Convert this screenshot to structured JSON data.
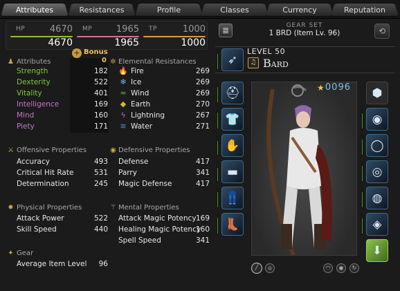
{
  "tabs": [
    {
      "label": "Attributes",
      "active": true
    },
    {
      "label": "Resistances",
      "active": false
    },
    {
      "label": "Profile",
      "active": false
    },
    {
      "label": "Classes",
      "active": false
    },
    {
      "label": "Currency",
      "active": false
    },
    {
      "label": "Reputation",
      "active": false
    }
  ],
  "vitals": {
    "hp": {
      "label": "HP",
      "top": "4670",
      "bottom": "4670",
      "color": "#8cc43a"
    },
    "mp": {
      "label": "MP",
      "top": "1965",
      "bottom": "1965",
      "color": "#d2709b"
    },
    "tp": {
      "label": "TP",
      "top": "1000",
      "bottom": "1000",
      "color": "#d5a23b"
    }
  },
  "attributes": {
    "title": "Attributes",
    "bonus_label": "Bonus",
    "bonus_value": "0",
    "items": [
      {
        "name": "Strength",
        "value": "182",
        "color": "#7ec83d"
      },
      {
        "name": "Dexterity",
        "value": "522",
        "color": "#7ec83d"
      },
      {
        "name": "Vitality",
        "value": "401",
        "color": "#7ec83d"
      },
      {
        "name": "Intelligence",
        "value": "169",
        "color": "#c875cc"
      },
      {
        "name": "Mind",
        "value": "160",
        "color": "#c875cc"
      },
      {
        "name": "Piety",
        "value": "171",
        "color": "#c875cc"
      }
    ]
  },
  "elemental": {
    "title": "Elemental Resistances",
    "items": [
      {
        "name": "Fire",
        "value": "269",
        "icon": "fire-icon",
        "glyph": "🔥",
        "color": "#e0483a"
      },
      {
        "name": "Ice",
        "value": "269",
        "icon": "ice-icon",
        "glyph": "❄",
        "color": "#6fb7ea"
      },
      {
        "name": "Wind",
        "value": "269",
        "icon": "wind-icon",
        "glyph": "≈",
        "color": "#5fc45a"
      },
      {
        "name": "Earth",
        "value": "270",
        "icon": "earth-icon",
        "glyph": "◆",
        "color": "#d8b43a"
      },
      {
        "name": "Lightning",
        "value": "267",
        "icon": "lightning-icon",
        "glyph": "ϟ",
        "color": "#b070d8"
      },
      {
        "name": "Water",
        "value": "271",
        "icon": "water-icon",
        "glyph": "≋",
        "color": "#4f8de0"
      }
    ]
  },
  "offensive": {
    "title": "Offensive Properties",
    "items": [
      {
        "name": "Accuracy",
        "value": "493"
      },
      {
        "name": "Critical Hit Rate",
        "value": "531"
      },
      {
        "name": "Determination",
        "value": "245"
      }
    ]
  },
  "defensive": {
    "title": "Defensive Properties",
    "items": [
      {
        "name": "Defense",
        "value": "417"
      },
      {
        "name": "Parry",
        "value": "341"
      },
      {
        "name": "Magic Defense",
        "value": "417"
      }
    ]
  },
  "physical": {
    "title": "Physical Properties",
    "items": [
      {
        "name": "Attack Power",
        "value": "522"
      },
      {
        "name": "Skill Speed",
        "value": "440"
      }
    ]
  },
  "mental": {
    "title": "Mental Properties",
    "items": [
      {
        "name": "Attack Magic Potency",
        "value": "169"
      },
      {
        "name": "Healing Magic Potency",
        "value": "160"
      },
      {
        "name": "Spell Speed",
        "value": "341"
      }
    ]
  },
  "gear": {
    "title": "Gear",
    "items": [
      {
        "name": "Average Item Level",
        "value": "96"
      }
    ]
  },
  "gearset": {
    "label": "GEAR SET",
    "value": "1 BRD (Item Lv. 96)"
  },
  "job": {
    "level": "LEVEL 50",
    "name": "Bard",
    "icon": "bard-harp-icon"
  },
  "item_count": "0096",
  "left_slots": [
    {
      "name": "head-gear-slot",
      "glyph": "⛑",
      "condition": 0.8
    },
    {
      "name": "body-gear-slot",
      "glyph": "👕",
      "condition": 0.85
    },
    {
      "name": "hands-gear-slot",
      "glyph": "✋",
      "condition": 0.75
    },
    {
      "name": "waist-gear-slot",
      "glyph": "▬",
      "condition": 0.7
    },
    {
      "name": "legs-gear-slot",
      "glyph": "👖",
      "condition": 0.8
    },
    {
      "name": "feet-gear-slot",
      "glyph": "👢",
      "condition": 0.85
    }
  ],
  "right_slots": [
    {
      "name": "offhand-empty-slot",
      "glyph": "⬢",
      "condition": 0
    },
    {
      "name": "earring-slot",
      "glyph": "◉",
      "condition": 0.8
    },
    {
      "name": "necklace-slot",
      "glyph": "◯",
      "condition": 0.8
    },
    {
      "name": "bracelet-slot",
      "glyph": "◎",
      "condition": 0.8
    },
    {
      "name": "ring-slot-1",
      "glyph": "◍",
      "condition": 0.8
    },
    {
      "name": "ring-slot-2",
      "glyph": "◈",
      "condition": 0.8
    },
    {
      "name": "soul-crystal-slot",
      "glyph": "⬇",
      "condition": 0
    }
  ]
}
